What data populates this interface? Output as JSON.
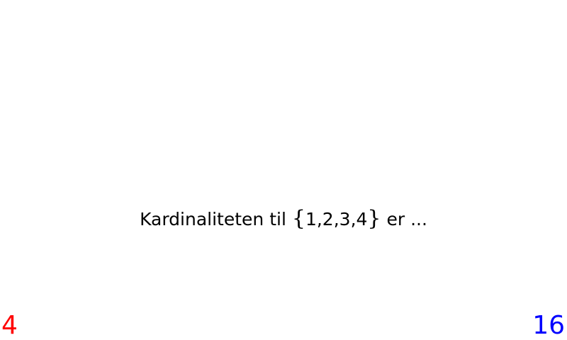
{
  "question": {
    "prefix": "Kardinaliteten til ",
    "open_brace": "{",
    "set_elements": "1,2,3,4",
    "close_brace": "}",
    "suffix": " er ..."
  },
  "answers": {
    "left": {
      "label": "4",
      "color": "#ff0000"
    },
    "right": {
      "label": "16",
      "color": "#0000ff"
    }
  }
}
